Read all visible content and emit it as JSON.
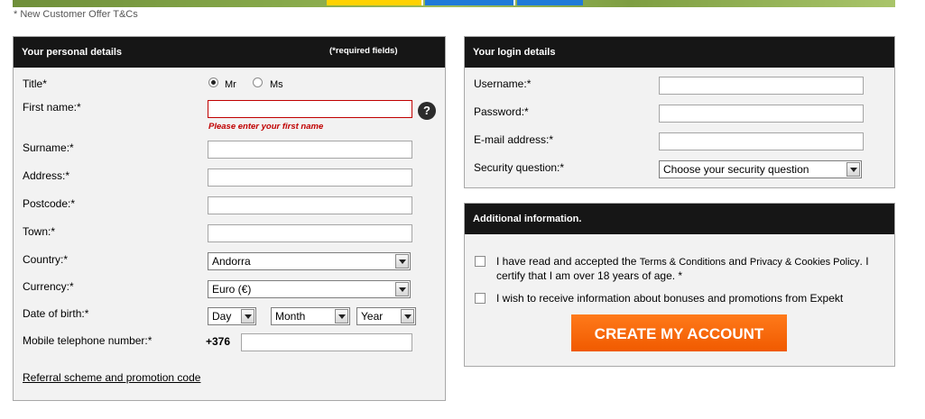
{
  "offer_text": "* New Customer Offer T&Cs",
  "personal": {
    "title": "Your personal details",
    "required_note": "(*required fields)",
    "title_label": "Title*",
    "mr": "Mr",
    "ms": "Ms",
    "firstname_label": "First name:*",
    "firstname_value": "",
    "firstname_error": "Please enter your first name",
    "help_icon": "?",
    "surname_label": "Surname:*",
    "address_label": "Address:*",
    "postcode_label": "Postcode:*",
    "town_label": "Town:*",
    "country_label": "Country:*",
    "country_value": "Andorra",
    "currency_label": "Currency:*",
    "currency_value": "Euro (€)",
    "dob_label": "Date of birth:*",
    "dob_day": "Day",
    "dob_month": "Month",
    "dob_year": "Year",
    "mobile_label": "Mobile telephone number:*",
    "mobile_prefix": "+376",
    "referral_link": "Referral scheme and promotion code"
  },
  "login": {
    "title": "Your login details",
    "username_label": "Username:*",
    "password_label": "Password:*",
    "email_label": "E-mail address:*",
    "security_label": "Security question:*",
    "security_value": "Choose your security question"
  },
  "additional": {
    "title": "Additional information.",
    "terms_a": "I have read and accepted the ",
    "terms_link1": "Terms & Conditions",
    "terms_and": " and ",
    "terms_link2": "Privacy & Cookies Policy",
    "terms_b": ". I certify that I am over 18 years of age. *",
    "bonus_text": "I wish to receive information about bonuses and promotions from Expekt",
    "cta": "CREATE MY ACCOUNT"
  },
  "colors": {
    "header": "#161616",
    "cta": "#f26a0f",
    "error": "#c00000"
  }
}
